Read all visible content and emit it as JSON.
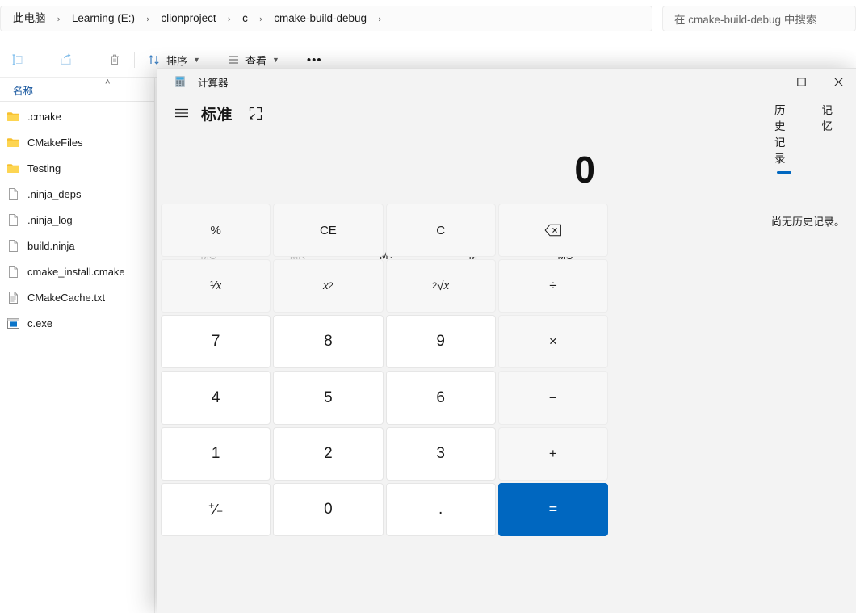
{
  "explorer": {
    "breadcrumb": {
      "items": [
        "此电脑",
        "Learning (E:)",
        "clionproject",
        "c",
        "cmake-build-debug"
      ],
      "separator": "›",
      "trailing_separator": "›"
    },
    "search": {
      "placeholder": "在 cmake-build-debug 中搜索"
    },
    "toolbar": {
      "icons": [
        "rename-icon",
        "share-icon",
        "delete-icon"
      ],
      "sort_label": "排序",
      "view_label": "查看",
      "more_label": "•••",
      "chevron": "⌄"
    },
    "column_header": {
      "name_label": "名称",
      "sort_indicator": "˄"
    },
    "files": [
      {
        "name": ".cmake",
        "type": "folder"
      },
      {
        "name": "CMakeFiles",
        "type": "folder"
      },
      {
        "name": "Testing",
        "type": "folder"
      },
      {
        "name": ".ninja_deps",
        "type": "file"
      },
      {
        "name": ".ninja_log",
        "type": "file"
      },
      {
        "name": "build.ninja",
        "type": "file"
      },
      {
        "name": "cmake_install.cmake",
        "type": "file"
      },
      {
        "name": "CMakeCache.txt",
        "type": "text"
      },
      {
        "name": "c.exe",
        "type": "exe"
      }
    ]
  },
  "calculator": {
    "title": "计算器",
    "window_controls": {
      "minimize": "minimize-icon",
      "maximize": "maximize-icon",
      "close": "close-icon"
    },
    "mode": {
      "menu": "hamburger-icon",
      "title": "标准",
      "keep_on_top": "keep-on-top-icon"
    },
    "side_panel": {
      "tabs": [
        {
          "label": "历史记录",
          "active": true
        },
        {
          "label": "记忆",
          "active": false
        }
      ],
      "empty_text": "尚无历史记录。"
    },
    "display": {
      "value": "0"
    },
    "memory_buttons": [
      {
        "label": "MC",
        "enabled": false
      },
      {
        "label": "MR",
        "enabled": false
      },
      {
        "label": "M+",
        "enabled": true
      },
      {
        "label": "M−",
        "enabled": true
      },
      {
        "label": "MS",
        "enabled": true
      }
    ],
    "keys": [
      {
        "label": "%",
        "kind": "fn",
        "name": "percent"
      },
      {
        "label": "CE",
        "kind": "fn",
        "name": "clear-entry"
      },
      {
        "label": "C",
        "kind": "fn",
        "name": "clear"
      },
      {
        "label": "⌫",
        "kind": "fn",
        "name": "backspace"
      },
      {
        "label": "1/x",
        "kind": "fn",
        "name": "reciprocal",
        "html": "<span class='nowrap'>¹⁄<span class='ital'>x</span></span>"
      },
      {
        "label": "x²",
        "kind": "fn",
        "name": "square",
        "html": "<span class='ital'>x</span><span class='sup'>2</span>"
      },
      {
        "label": "²√x",
        "kind": "fn",
        "name": "square-root",
        "html": "<span class='sup'>2</span>√<span class='ital' style='text-decoration:overline'>x</span>"
      },
      {
        "label": "÷",
        "kind": "op",
        "name": "divide"
      },
      {
        "label": "7",
        "kind": "num",
        "name": "seven"
      },
      {
        "label": "8",
        "kind": "num",
        "name": "eight"
      },
      {
        "label": "9",
        "kind": "num",
        "name": "nine"
      },
      {
        "label": "×",
        "kind": "op",
        "name": "multiply"
      },
      {
        "label": "4",
        "kind": "num",
        "name": "four"
      },
      {
        "label": "5",
        "kind": "num",
        "name": "five"
      },
      {
        "label": "6",
        "kind": "num",
        "name": "six"
      },
      {
        "label": "−",
        "kind": "op",
        "name": "subtract"
      },
      {
        "label": "1",
        "kind": "num",
        "name": "one"
      },
      {
        "label": "2",
        "kind": "num",
        "name": "two"
      },
      {
        "label": "3",
        "kind": "num",
        "name": "three"
      },
      {
        "label": "+",
        "kind": "op",
        "name": "add"
      },
      {
        "label": "+/-",
        "kind": "num",
        "name": "negate",
        "html": "<span class='nowrap'><span class='sup' style='font-size:12px'>+</span>⁄<span style='font-size:13px'>−</span></span>"
      },
      {
        "label": "0",
        "kind": "num",
        "name": "zero"
      },
      {
        "label": ".",
        "kind": "num",
        "name": "decimal"
      },
      {
        "label": "=",
        "kind": "eq",
        "name": "equals"
      }
    ]
  },
  "colors": {
    "accent": "#0067c0",
    "folder": "#ffb900",
    "window_bg": "#f3f3f3",
    "key_num": "#ffffff",
    "key_fn": "#f7f7f7",
    "header_link": "#1c5aa0"
  }
}
